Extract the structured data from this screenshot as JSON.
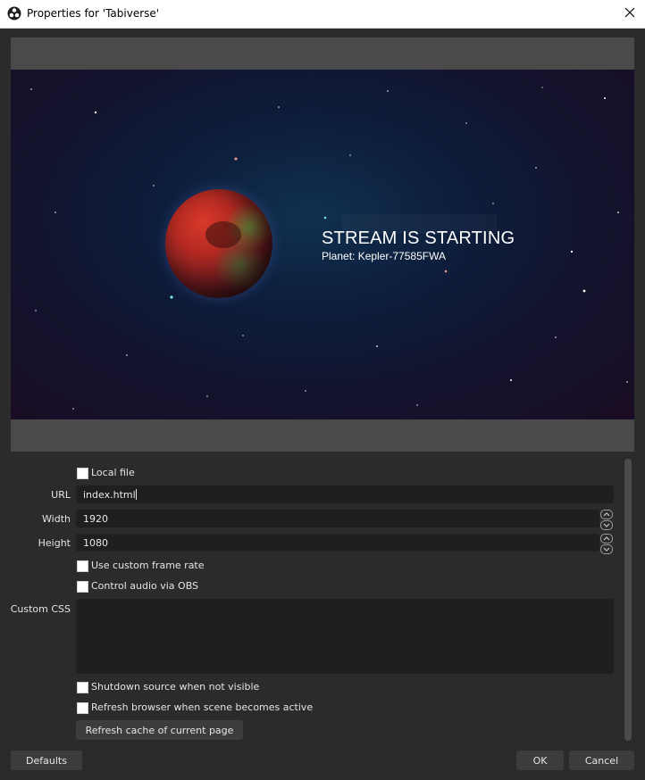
{
  "window": {
    "title": "Properties for 'Tabiverse'",
    "app_icon": "obs-logo-icon",
    "close_icon": "close-icon"
  },
  "preview": {
    "headline": "STREAM IS STARTING",
    "subtitle": "Planet: Kepler-77585FWA"
  },
  "form": {
    "local_file_label": "Local file",
    "url_label": "URL",
    "url_value": "index.html",
    "width_label": "Width",
    "width_value": "1920",
    "height_label": "Height",
    "height_value": "1080",
    "custom_frame_rate_label": "Use custom frame rate",
    "control_audio_label": "Control audio via OBS",
    "custom_css_label": "Custom CSS",
    "custom_css_value": "",
    "shutdown_label": "Shutdown source when not visible",
    "refresh_browser_label": "Refresh browser when scene becomes active",
    "refresh_cache_label": "Refresh cache of current page"
  },
  "footer": {
    "defaults_label": "Defaults",
    "ok_label": "OK",
    "cancel_label": "Cancel"
  },
  "colors": {
    "background": "#2b2b2b",
    "field": "#1f1f1f",
    "button": "#3d3d3d",
    "preview_border": "#4a4a4a"
  }
}
